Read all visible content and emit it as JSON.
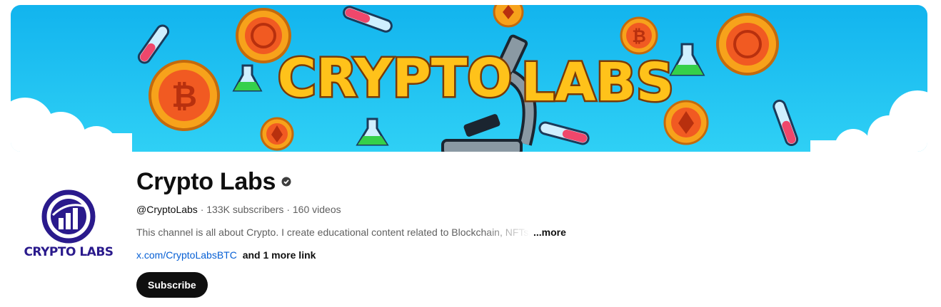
{
  "banner": {
    "text_left": "CRYPTO",
    "text_right": "LABS",
    "colors": {
      "sky": "#19c3f0",
      "sky_dark": "#0fa8e6",
      "coin_gold": "#f7a21b",
      "coin_inner": "#f15a22",
      "text_gold": "#ffc21a",
      "cloud": "#ffffff"
    },
    "icons": [
      "bitcoin-coin-icon",
      "ethereum-coin-icon",
      "microscope-icon",
      "test-tube-icon",
      "flask-icon"
    ]
  },
  "avatar": {
    "label": "CRYPTO LABS",
    "color": "#2a1a8c",
    "icon": "chart-ring-logo-icon"
  },
  "channel": {
    "title": "Crypto Labs",
    "verified_icon": "verified-check-icon",
    "handle": "@CryptoLabs",
    "separator": " · ",
    "subscribers": "133K subscribers",
    "videos": "160 videos",
    "description": "This channel is all about Crypto. I create educational content related to Blockchain, NFTs, ",
    "more_label": "...more",
    "link_url": "x.com/CryptoLabsBTC",
    "more_links": "and 1 more link",
    "subscribe_label": "Subscribe"
  }
}
